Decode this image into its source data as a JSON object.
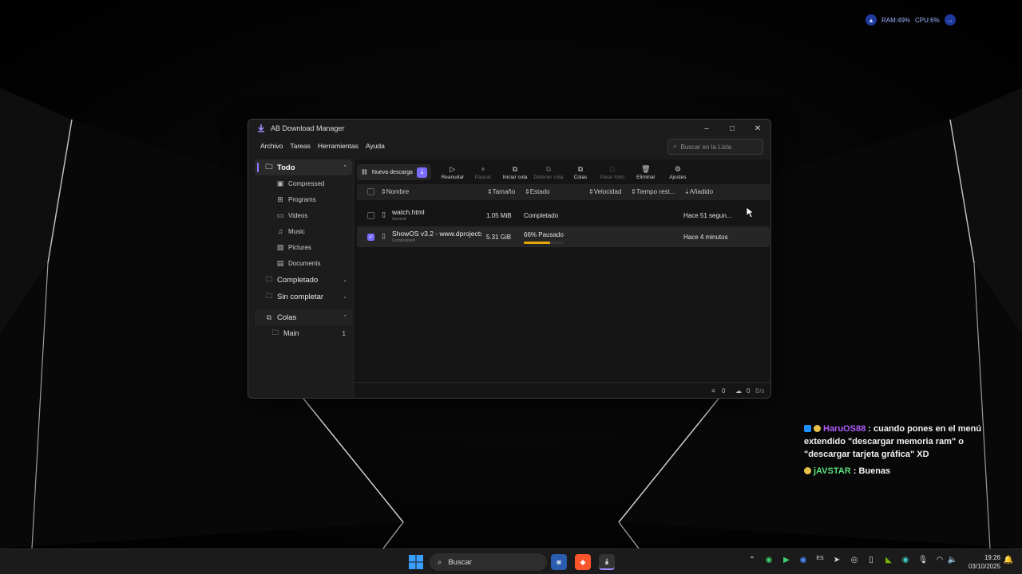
{
  "system_monitor": {
    "ram": "RAM:49%",
    "cpu": "CPU:6%"
  },
  "window": {
    "title": "AB Download Manager",
    "controls": {
      "minimize": "–",
      "maximize": "□",
      "close": "✕"
    }
  },
  "menu": [
    "Archivo",
    "Tareas",
    "Herramientas",
    "Ayuda"
  ],
  "search": {
    "placeholder": "Buscar en la Lista"
  },
  "sidebar": {
    "all": "Todo",
    "categories": [
      "Compressed",
      "Programs",
      "Videos",
      "Music",
      "Pictures",
      "Documents"
    ],
    "completed": "Completado",
    "incomplete": "Sin completar",
    "queues": "Colas",
    "queue_items": [
      {
        "name": "Main",
        "count": "1"
      }
    ]
  },
  "toolbar": {
    "new_download": "Nueva descarga",
    "buttons": [
      "Reanudar",
      "Pausar",
      "Iniciar cola",
      "Detener cola",
      "Colas",
      "Parar todo",
      "Eliminar",
      "Ajustes"
    ]
  },
  "table": {
    "columns": [
      "Nombre",
      "Tamaño",
      "Estado",
      "Velocidad",
      "Tiempo rest...",
      "Añadido"
    ],
    "rows": [
      {
        "name": "watch.html",
        "category": "General",
        "size": "1.05 MiB",
        "state": "Completado",
        "added": "Hace 51 segun...",
        "selected": false
      },
      {
        "name": "ShowOS v3.2 - www.dprojects....",
        "category": "Compressed",
        "size": "5.31 GiB",
        "state": "66% Pausado",
        "added": "Hace 4 minutos",
        "selected": true,
        "progress": 0.66
      }
    ]
  },
  "statusbar": {
    "active_count": "0",
    "speed_count": "0",
    "speed_unit": "B/s"
  },
  "chat": [
    {
      "user": "HaruOS88",
      "text": ": cuando pones en el menú extendido \"descargar memoria ram\" o \"descargar tarjeta gráfica\" XD"
    },
    {
      "user": "jAVSTAR",
      "text": ": Buenas"
    }
  ],
  "taskbar": {
    "search_label": "Buscar",
    "clock_time": "19:26",
    "clock_date": "03/10/2025"
  },
  "colors": {
    "accent": "#7a6cff",
    "progress": "#e6a800",
    "chat_user1": "#b05cff",
    "chat_user2": "#5be07e"
  }
}
